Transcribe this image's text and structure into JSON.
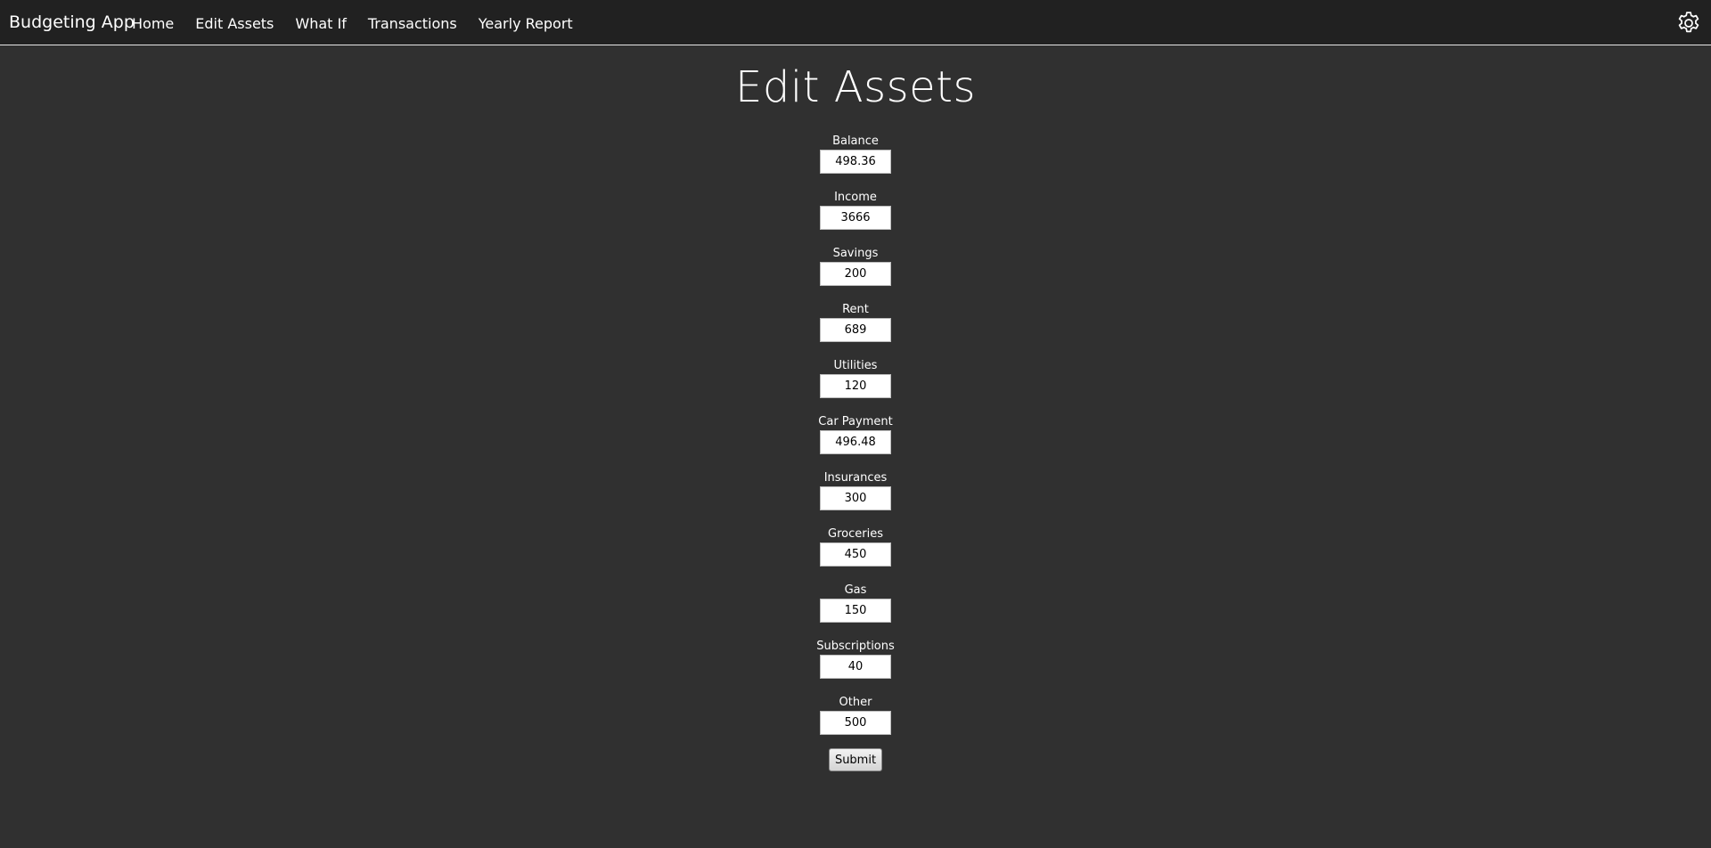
{
  "navbar": {
    "brand": "Budgeting App",
    "links": [
      {
        "label": "Home"
      },
      {
        "label": "Edit Assets"
      },
      {
        "label": "What If"
      },
      {
        "label": "Transactions"
      },
      {
        "label": "Yearly Report"
      }
    ],
    "settings_icon": "gear-icon"
  },
  "page": {
    "title": "Edit Assets"
  },
  "form": {
    "fields": [
      {
        "label": "Balance",
        "value": "498.36"
      },
      {
        "label": "Income",
        "value": "3666"
      },
      {
        "label": "Savings",
        "value": "200"
      },
      {
        "label": "Rent",
        "value": "689"
      },
      {
        "label": "Utilities",
        "value": "120"
      },
      {
        "label": "Car Payment",
        "value": "496.48"
      },
      {
        "label": "Insurances",
        "value": "300"
      },
      {
        "label": "Groceries",
        "value": "450"
      },
      {
        "label": "Gas",
        "value": "150"
      },
      {
        "label": "Subscriptions",
        "value": "40"
      },
      {
        "label": "Other",
        "value": "500"
      }
    ],
    "submit_label": "Submit"
  },
  "colors": {
    "background": "#303030",
    "navbar": "#212121",
    "text": "#ffffff"
  }
}
